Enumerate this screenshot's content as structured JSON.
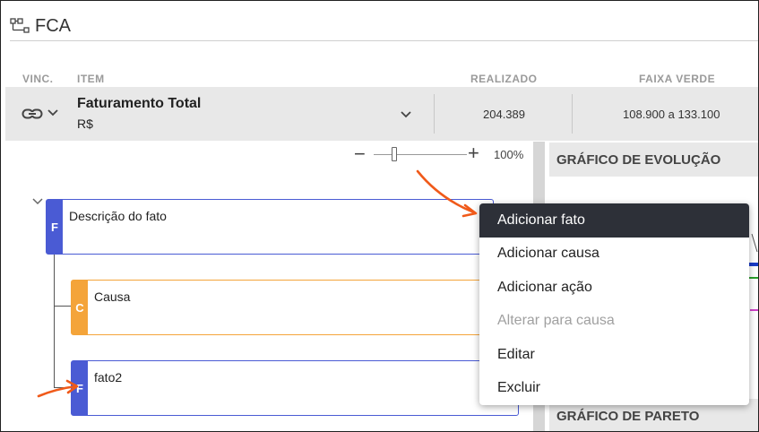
{
  "header": {
    "title": "FCA",
    "icon": "tree-structure-icon"
  },
  "columns": {
    "vinc": "VINC.",
    "item": "ITEM",
    "realizado": "REALIZADO",
    "faixa_verde": "FAIXA VERDE"
  },
  "item_row": {
    "title": "Faturamento Total",
    "unit": "R$",
    "realizado": "204.389",
    "faixa_verde": "108.900 a 133.100"
  },
  "zoom": {
    "minus": "−",
    "plus": "+",
    "level": "100%"
  },
  "tree": {
    "root": {
      "tag": "F",
      "text": "Descrição do fato"
    },
    "children": [
      {
        "tag": "C",
        "text": "Causa"
      },
      {
        "tag": "F",
        "text": "fato2"
      }
    ]
  },
  "panels": {
    "evolucao": "GRÁFICO DE EVOLUÇÃO",
    "pareto": "GRÁFICO DE PARETO"
  },
  "context_menu": {
    "items": [
      {
        "label": "Adicionar fato",
        "state": "hover"
      },
      {
        "label": "Adicionar causa",
        "state": "normal"
      },
      {
        "label": "Adicionar ação",
        "state": "normal"
      },
      {
        "label": "Alterar para causa",
        "state": "disabled"
      },
      {
        "label": "Editar",
        "state": "normal"
      },
      {
        "label": "Excluir",
        "state": "normal"
      }
    ]
  },
  "colors": {
    "fato": "#4a5bd4",
    "causa": "#f4a43a",
    "menu_active_bg": "#2d3038",
    "annotation_arrow": "#f05a1a"
  }
}
